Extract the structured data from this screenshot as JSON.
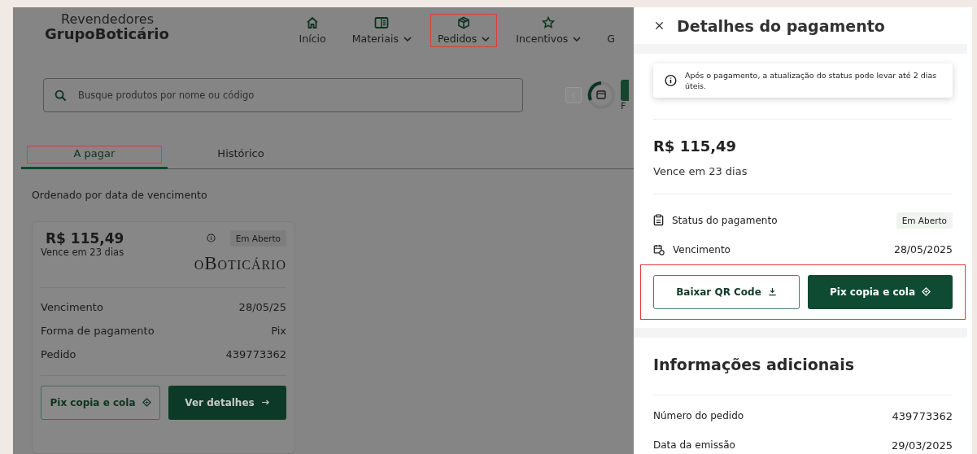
{
  "header": {
    "brand_top": "Revendedores",
    "brand_bottom": "GrupoBoticário",
    "nav": [
      {
        "label": "Início",
        "dropdown": false,
        "annotated": false
      },
      {
        "label": "Materiais",
        "dropdown": true,
        "annotated": false
      },
      {
        "label": "Pedidos",
        "dropdown": true,
        "annotated": true
      },
      {
        "label": "Incentivos",
        "dropdown": true,
        "annotated": false
      },
      {
        "label": "G",
        "dropdown": false,
        "annotated": false
      }
    ]
  },
  "search": {
    "placeholder": "Busque produtos por nome ou código"
  },
  "side_label": "F",
  "tabs": [
    {
      "label": "A pagar",
      "selected": true,
      "annotated": true
    },
    {
      "label": "Histórico",
      "selected": false,
      "annotated": false
    }
  ],
  "sort_note": "Ordenado por data de vencimento",
  "card": {
    "amount": "R$ 115,49",
    "due": "Vence em 23 dias",
    "status": "Em Aberto",
    "brand": "oBoticário",
    "rows": [
      {
        "label": "Vencimento",
        "value": "28/05/25"
      },
      {
        "label": "Forma de pagamento",
        "value": "Pix"
      },
      {
        "label": "Pedido",
        "value": "439773362"
      }
    ],
    "buttons": [
      {
        "label": "Pix copia e cola",
        "kind": "outline"
      },
      {
        "label": "Ver detalhes",
        "kind": "solid"
      }
    ]
  },
  "drawer": {
    "title": "Detalhes do pagamento",
    "notice": "Após o pagamento, a atualização do status pode levar até 2 dias úteis.",
    "amount": "R$ 115,49",
    "due": "Vence em 23 dias",
    "details": [
      {
        "label": "Status do pagamento",
        "value": "Em Aberto",
        "kind": "chip"
      },
      {
        "label": "Vencimento",
        "value": "28/05/2025",
        "kind": "text"
      }
    ],
    "actions_annotated": true,
    "buttons": [
      {
        "label": "Baixar QR Code",
        "kind": "outline"
      },
      {
        "label": "Pix copia e cola",
        "kind": "solid"
      }
    ],
    "info_title": "Informações adicionais",
    "info": [
      {
        "label": "Número do pedido",
        "value": "439773362"
      },
      {
        "label": "Data da emissão",
        "value": "29/03/2025"
      }
    ]
  }
}
